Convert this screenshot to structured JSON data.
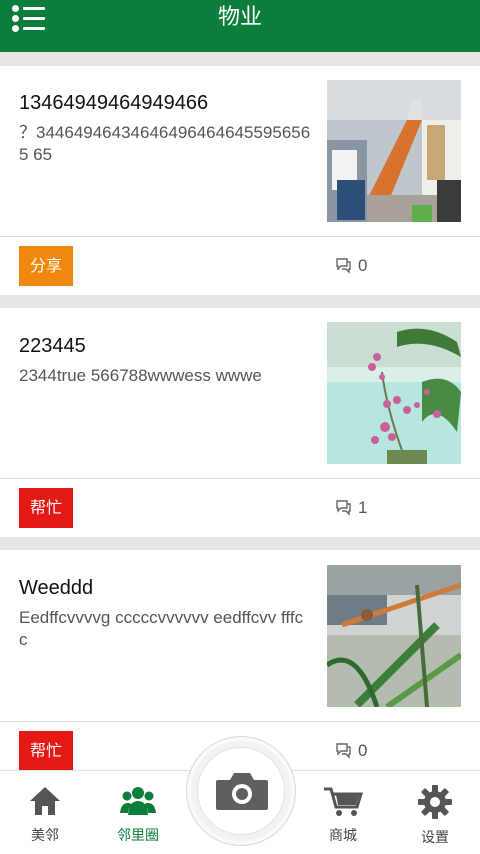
{
  "header": {
    "title": "物业",
    "menu_icon": "list-menu-icon"
  },
  "posts": [
    {
      "title": "13464949464949466",
      "description": "？344649464346464964646455956565 65",
      "tag": "分享",
      "tag_color": "#f0880f",
      "comment_count": "0"
    },
    {
      "title": "223445",
      "description": "2344true 566788wwwess wwwe",
      "tag": "帮忙",
      "tag_color": "#e41814",
      "comment_count": "1"
    },
    {
      "title": "Weeddd",
      "description": "Eedffcvvvvg cccccvvvvvv eedffcvv fffcc",
      "tag": "帮忙",
      "tag_color": "#e41814",
      "comment_count": "0"
    }
  ],
  "bottom_nav": {
    "items": [
      {
        "label": "美邻",
        "icon": "home-icon"
      },
      {
        "label": "邻里圈",
        "icon": "people-icon",
        "active": true
      },
      {
        "label": "商城",
        "icon": "cart-icon"
      },
      {
        "label": "设置",
        "icon": "gear-icon"
      }
    ],
    "center_icon": "camera-icon"
  },
  "colors": {
    "primary": "#0d7d3b",
    "share_tag": "#f0880f",
    "help_tag": "#e41814"
  }
}
